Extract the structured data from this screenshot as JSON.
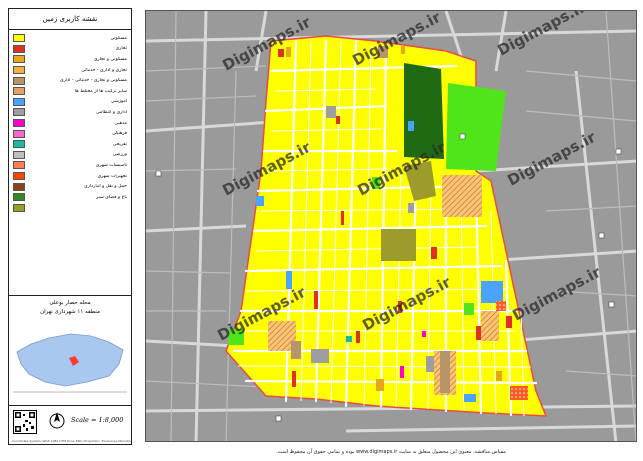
{
  "legend": {
    "title": "نقشه کاربری زمین",
    "items": [
      {
        "label": "مسکونی",
        "color": "#ffff00"
      },
      {
        "label": "تجاری",
        "color": "#e0301e"
      },
      {
        "label": "مسکونی و تجاری",
        "color": "#e6a817"
      },
      {
        "label": "تجاری و اداری - خدماتی",
        "color": "#f5b041"
      },
      {
        "label": "مسکونی و تجاری - خدماتی - اداری",
        "color": "#b8946a"
      },
      {
        "label": "سایر ترکیب ها از مختلط ها",
        "color": "#e8a060"
      },
      {
        "label": "آموزشی",
        "color": "#4aa3ff"
      },
      {
        "label": "اداری و انتظامی",
        "color": "#9e9e9e"
      },
      {
        "label": "مذهبی",
        "color": "#ff00cc"
      },
      {
        "label": "فرهنگی",
        "color": "#ff66cc"
      },
      {
        "label": "تفریحی",
        "color": "#1abc9c"
      },
      {
        "label": "ورزشی",
        "color": "#bfbfbf"
      },
      {
        "label": "تاسیسات شهری",
        "color": "#ff7f50"
      },
      {
        "label": "تجهیزات شهری",
        "color": "#ff4500"
      },
      {
        "label": "حمل و نقل و انبارداری",
        "color": "#8b4513"
      },
      {
        "label": "باغ و فضای سبز",
        "color": "#2e8b22"
      },
      {
        "label": "",
        "color": "#9c9c2a"
      }
    ]
  },
  "inset": {
    "title": "محله حصار بوعلی",
    "subtitle": "منطقه ۱۱ شهرداری تهران"
  },
  "scale_text": "Scale = 1:8,000",
  "north_label": "N",
  "note_text": "Coordinate System: WGS 1984 UTM Zone 39N | Projection: Transverse Mercator",
  "watermark": "Digimaps.ir",
  "footer": "مقیاس مناقشه، معنوی این محصول متعلق به سایت www.digimaps.ir بوده و تمامی حقوق آن محفوظ است.",
  "colors": {
    "residential": "#ffff00",
    "street": "#ffffff",
    "boundary": "#e84a4a",
    "background": "#9a9a9a",
    "dark_green": "#1f6a12",
    "light_green": "#4fe51a",
    "blue": "#4aa3ff",
    "grey": "#9e9e9e",
    "olive": "#9c9c2a",
    "brown": "#b8946a"
  }
}
